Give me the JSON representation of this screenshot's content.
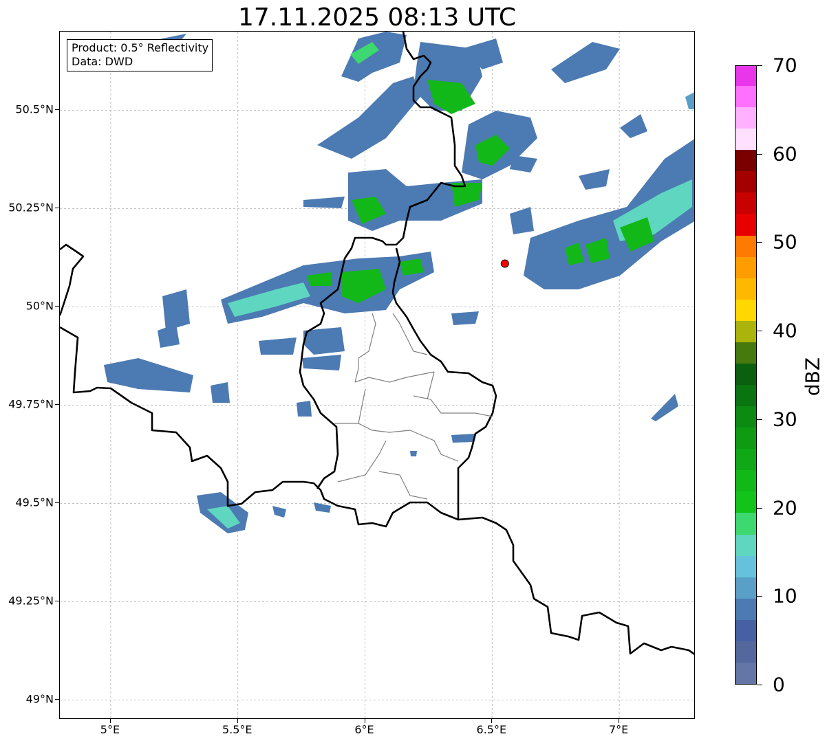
{
  "title": "17.11.2025 08:13 UTC",
  "info": {
    "product": "Product: 0.5° Reflectivity",
    "source": "Data: DWD"
  },
  "axes": {
    "lat_ticks": [
      "50.5°N",
      "50.25°N",
      "50°N",
      "49.75°N",
      "49.5°N",
      "49.25°N",
      "49°N"
    ],
    "lon_ticks": [
      "5°E",
      "5.5°E",
      "6°E",
      "6.5°E",
      "7°E"
    ],
    "lat_values": [
      50.5,
      50.25,
      50.0,
      49.75,
      49.5,
      49.25,
      49.0
    ],
    "lon_values": [
      5.0,
      5.5,
      6.0,
      6.5,
      7.0
    ],
    "lon_range": [
      4.8,
      7.3
    ],
    "lat_range": [
      48.95,
      50.7
    ],
    "grid": "dashed"
  },
  "colorbar": {
    "label": "dBZ",
    "ticks": [
      "0",
      "10",
      "20",
      "30",
      "40",
      "50",
      "60",
      "70"
    ],
    "min": 0,
    "max": 70,
    "colors": [
      "#6476a8",
      "#54689e",
      "#4660a4",
      "#4c7ab2",
      "#5a9fc8",
      "#66c2dc",
      "#5fd6c0",
      "#3dd870",
      "#12c41a",
      "#12b818",
      "#10a816",
      "#0f9a14",
      "#0c8a12",
      "#0a7410",
      "#0a600e",
      "#467a0e",
      "#aab40a",
      "#ffd800",
      "#ffb800",
      "#ff9c00",
      "#ff7a00",
      "#e80000",
      "#c80000",
      "#a40000",
      "#7a0000",
      "#ffe0ff",
      "#ffb0ff",
      "#ff70ff",
      "#ea36ea"
    ]
  },
  "radar_site": {
    "name": "radar-site",
    "lon": 6.55,
    "lat": 50.11,
    "color": "#ff0000"
  },
  "colors": {
    "border": "#000000",
    "district": "#808080"
  }
}
